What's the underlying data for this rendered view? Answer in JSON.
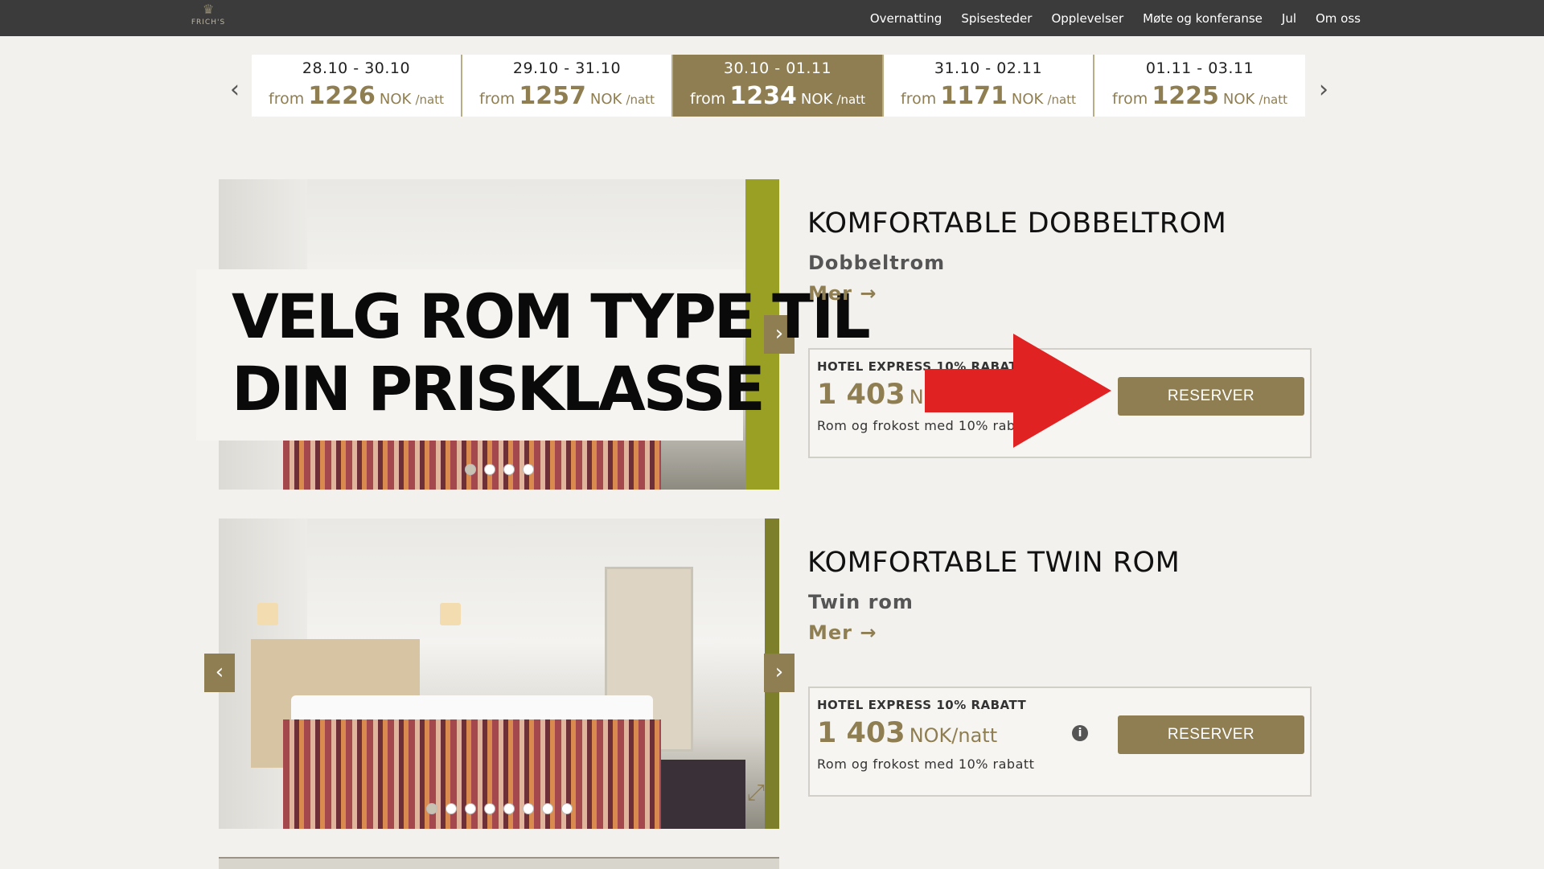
{
  "nav": {
    "logo_text": "FRICH'S",
    "items": [
      "Overnatting",
      "Spisesteder",
      "Opplevelser",
      "Møte og konferanse",
      "Jul",
      "Om oss"
    ]
  },
  "date_strip": {
    "active_index": 2,
    "cards": [
      {
        "range": "28.10 - 30.10",
        "from": "from",
        "amount": "1226",
        "currency": "NOK",
        "per": "/natt"
      },
      {
        "range": "29.10 - 31.10",
        "from": "from",
        "amount": "1257",
        "currency": "NOK",
        "per": "/natt"
      },
      {
        "range": "30.10 - 01.11",
        "from": "from",
        "amount": "1234",
        "currency": "NOK",
        "per": "/natt"
      },
      {
        "range": "31.10 - 02.11",
        "from": "from",
        "amount": "1171",
        "currency": "NOK",
        "per": "/natt"
      },
      {
        "range": "01.11 - 03.11",
        "from": "from",
        "amount": "1225",
        "currency": "NOK",
        "per": "/natt"
      }
    ]
  },
  "overlay": {
    "line1": "VELG ROM TYPE TIL",
    "line2": "DIN PRISKLASSE"
  },
  "rooms": [
    {
      "title": "KOMFORTABLE DOBBELTROM",
      "subtitle": "Dobbeltrom",
      "more": "Mer →",
      "rate_name": "HOTEL EXPRESS 10% RABATT",
      "price": "1 403",
      "unit": "NOK/natt",
      "description": "Rom og frokost med 10% rabatt",
      "button": "RESERVER"
    },
    {
      "title": "KOMFORTABLE TWIN ROM",
      "subtitle": "Twin rom",
      "more": "Mer →",
      "rate_name": "HOTEL EXPRESS 10% RABATT",
      "price": "1 403",
      "unit": "NOK/natt",
      "description": "Rom og frokost med 10% rabatt",
      "button": "RESERVER"
    }
  ],
  "colors": {
    "accent": "#8f7e52",
    "topbar": "#3b3b3b",
    "background": "#f2f1ed",
    "arrow": "#e02222"
  }
}
